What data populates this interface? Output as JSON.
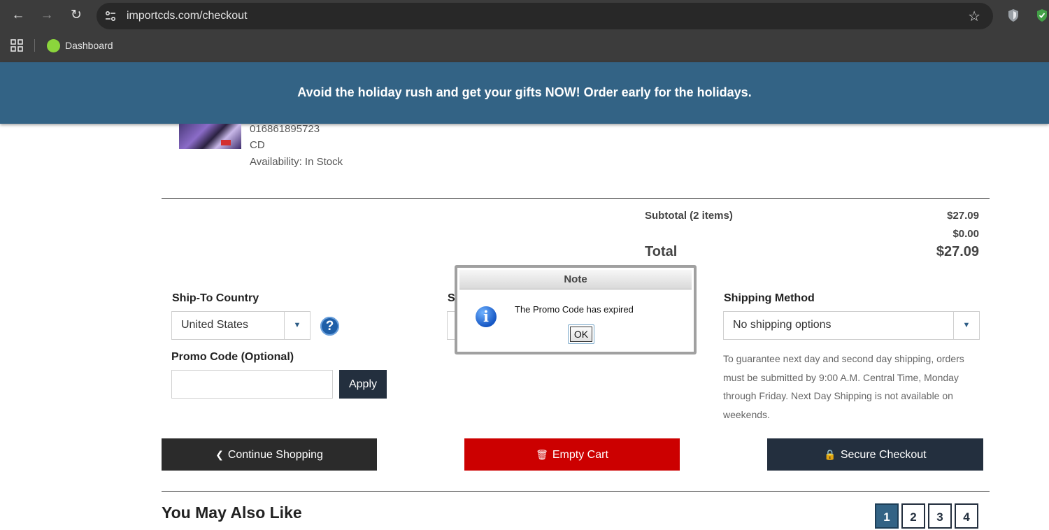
{
  "browser": {
    "url": "importcds.com/checkout",
    "bookmark_label": "Dashboard"
  },
  "banner": {
    "text": "Avoid the holiday rush and get your gifts NOW! Order early for the holidays."
  },
  "product": {
    "upc": "016861895723",
    "format": "CD",
    "availability": "Availability: In Stock"
  },
  "totals": {
    "subtotal_label": "Subtotal (2 items)",
    "subtotal_value": "$27.09",
    "shipping_value": "$0.00",
    "total_label": "Total",
    "total_value": "$27.09"
  },
  "ship_to": {
    "label": "Ship-To Country",
    "selected": "United States"
  },
  "middle_column": {
    "label_partial": "S"
  },
  "shipping_method": {
    "label": "Shipping Method",
    "selected": "No shipping options",
    "note": "To guarantee next day and second day shipping, orders must be submitted by 9:00 A.M. Central Time, Monday through Friday. Next Day Shipping is not available on weekends."
  },
  "promo": {
    "label": "Promo Code (Optional)",
    "value": "",
    "apply_label": "Apply"
  },
  "actions": {
    "continue_label": "Continue Shopping",
    "empty_label": "Empty Cart",
    "checkout_label": "Secure Checkout"
  },
  "also_like": {
    "title": "You May Also Like",
    "pages": [
      "1",
      "2",
      "3",
      "4"
    ]
  },
  "dialog": {
    "title": "Note",
    "message": "The Promo Code has expired",
    "ok_label": "OK"
  },
  "colors": {
    "banner": "#336385",
    "dark_button": "#232f3e",
    "continue_button": "#2b2b2b",
    "empty_button": "#cc0000"
  }
}
